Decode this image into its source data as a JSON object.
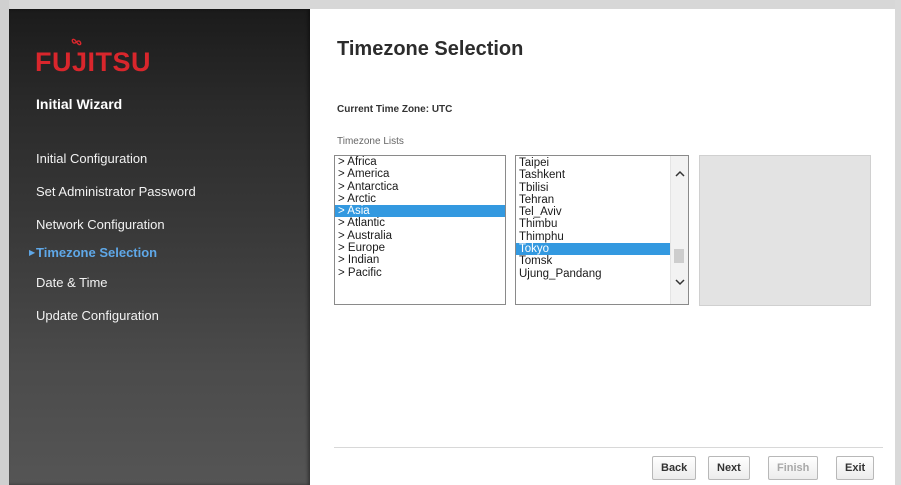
{
  "sidebar": {
    "logo": "FUJITSU",
    "title": "Initial Wizard",
    "items": [
      {
        "label": "Initial Configuration",
        "active": false
      },
      {
        "label": "Set Administrator Password",
        "active": false
      },
      {
        "label": "Network Configuration",
        "active": false
      },
      {
        "label": "Timezone Selection",
        "active": true
      },
      {
        "label": "Date & Time",
        "active": false
      },
      {
        "label": "Update Configuration",
        "active": false
      }
    ]
  },
  "main": {
    "title": "Timezone Selection",
    "current_timezone": "Current Time Zone: UTC",
    "lists_label": "Timezone Lists",
    "regions": [
      "> Africa",
      "> America",
      "> Antarctica",
      "> Arctic",
      "> Asia",
      "> Atlantic",
      "> Australia",
      "> Europe",
      "> Indian",
      "> Pacific"
    ],
    "regions_selected": "> Asia",
    "zones": [
      "Taipei",
      "Tashkent",
      "Tbilisi",
      "Tehran",
      "Tel_Aviv",
      "Thimbu",
      "Thimphu",
      "Tokyo",
      "Tomsk",
      "Ujung_Pandang"
    ],
    "zones_selected": "Tokyo"
  },
  "buttons": {
    "back": "Back",
    "next": "Next",
    "finish": "Finish",
    "exit": "Exit"
  },
  "colors": {
    "brand": "#d9262c",
    "accent": "#5fa8e8",
    "selection": "#3399e0"
  }
}
